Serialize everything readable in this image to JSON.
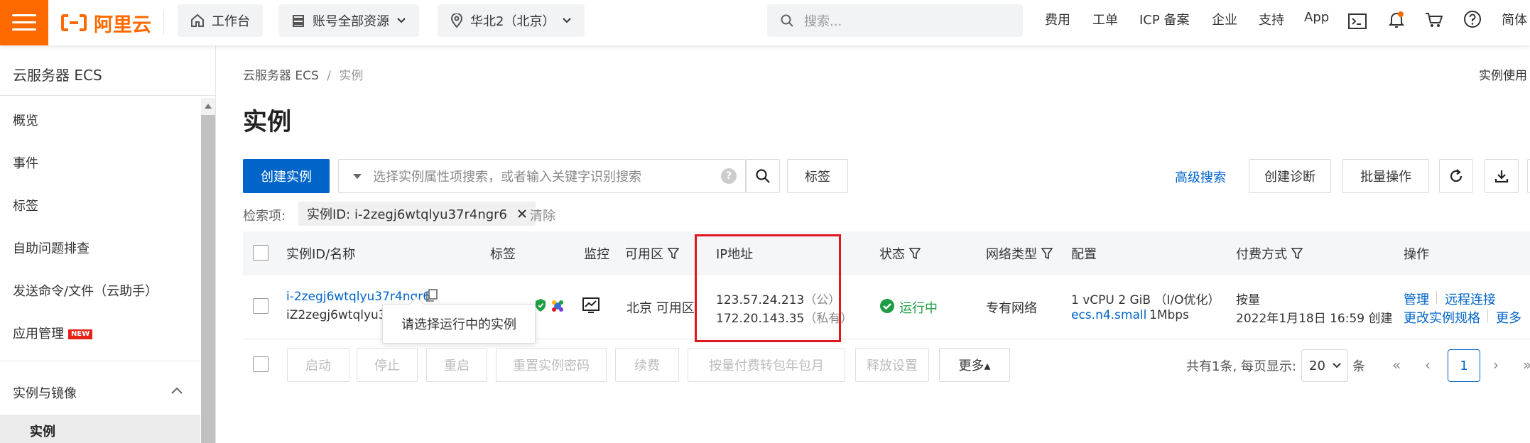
{
  "topbar": {
    "logo_text": "阿里云",
    "workbench": "工作台",
    "account_resources": "账号全部资源",
    "region": "华北2（北京）",
    "search_placeholder": "搜索...",
    "links": [
      "费用",
      "工单",
      "ICP 备案",
      "企业",
      "支持",
      "App"
    ],
    "lang": "简体"
  },
  "sidebar": {
    "title": "云服务器 ECS",
    "items": [
      "概览",
      "事件",
      "标签",
      "自助问题排查",
      "发送命令/文件（云助手）",
      "应用管理"
    ],
    "new_badge": "NEW",
    "group": "实例与镜像",
    "active_item": "实例"
  },
  "breadcrumb": {
    "root": "云服务器 ECS",
    "sep": "/",
    "current": "实例"
  },
  "top_right_link": "实例使用",
  "page_title": "实例",
  "toolbar": {
    "create": "创建实例",
    "search_placeholder": "选择实例属性项搜索，或者输入关键字识别搜索",
    "tags": "标签",
    "advanced_search": "高级搜索",
    "create_diagnosis": "创建诊断",
    "batch": "批量操作"
  },
  "filter": {
    "label": "检索项:",
    "chip": "实例ID: i-2zegj6wtqlyu37r4ngr6",
    "clear": "清除"
  },
  "table": {
    "headers": [
      "实例ID/名称",
      "标签",
      "监控",
      "可用区",
      "IP地址",
      "状态",
      "网络类型",
      "配置",
      "付费方式",
      "操作"
    ],
    "rows": [
      {
        "instance_id": "i-2zegj6wtqlyu37r4ngr6",
        "instance_name": "iZ2zegj6wtqlyu37",
        "zone": "北京 可用区",
        "ip_public": "123.57.24.213",
        "ip_public_tag": "（公）",
        "ip_private": "172.20.143.35",
        "ip_private_tag": "（私有）",
        "status": "运行中",
        "network": "专有网络",
        "config_line1": "1 vCPU 2 GiB （I/O优化）",
        "config_type": "ecs.n4.small",
        "config_bw": "1Mbps",
        "billing": "按量",
        "billing_time": "2022年1月18日 16:59 创建",
        "actions_line1": [
          "管理",
          "远程连接"
        ],
        "actions_line2": [
          "更改实例规格",
          "更多"
        ]
      }
    ]
  },
  "tooltip": "请选择运行中的实例",
  "footer_buttons": [
    "启动",
    "停止",
    "重启",
    "重置实例密码",
    "续费",
    "按量付费转包年包月",
    "释放设置"
  ],
  "more_button": "更多▴",
  "pagination": {
    "summary": "共有1条, 每页显示:",
    "page_size": "20",
    "unit": "条",
    "current": "1"
  },
  "colors": {
    "brand": "#ff6a00",
    "primary": "#0064c8",
    "highlight": "#e0161f",
    "running": "#1e9e44"
  }
}
